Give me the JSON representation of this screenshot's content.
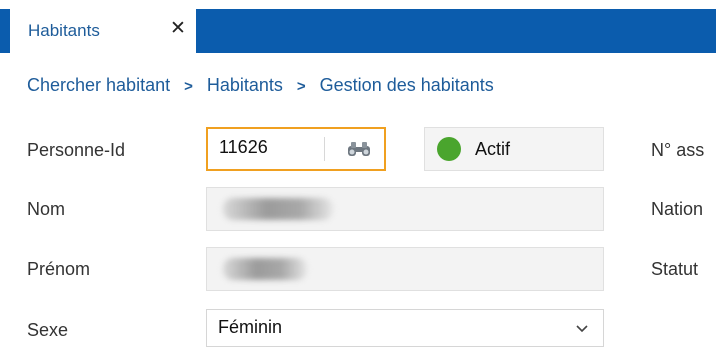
{
  "tab": {
    "label": "Habitants",
    "close": "✕"
  },
  "breadcrumb": [
    "Chercher habitant",
    "Habitants",
    "Gestion des habitants"
  ],
  "breadcrumb_separator": ">",
  "form": {
    "person_id": {
      "label": "Personne-Id",
      "value": "11626"
    },
    "status": {
      "value": "Actif",
      "color": "#4aa52d"
    },
    "nom": {
      "label": "Nom"
    },
    "prenom": {
      "label": "Prénom"
    },
    "sexe": {
      "label": "Sexe",
      "value": "Féminin"
    }
  },
  "right_labels": {
    "no_ass": "N° ass",
    "nation": "Nation",
    "statut": "Statut"
  },
  "colors": {
    "tabbar": "#0b5cad",
    "link": "#1e5c9a",
    "focus": "#f0a020"
  }
}
